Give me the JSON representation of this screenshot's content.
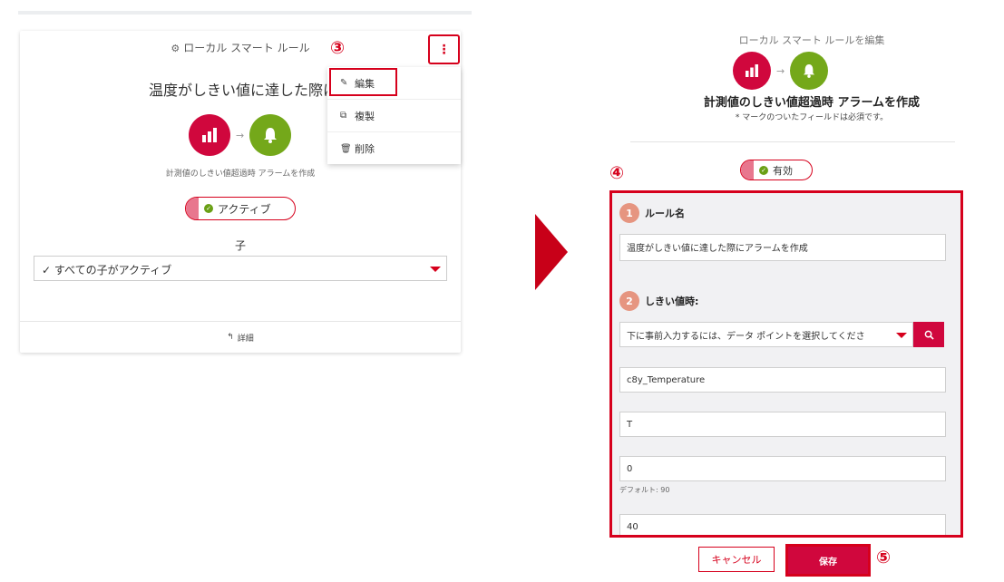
{
  "left_card": {
    "title": "ローカル スマート ルール",
    "rule_name": "温度がしきい値に達した際にアラー",
    "rule_subtitle": "計測値のしきい値超過時 アラームを作成",
    "toggle_label": "アクティブ",
    "children_label": "子",
    "children_select": "すべての子がアクティブ",
    "footer_label": "詳細"
  },
  "menu": {
    "items": [
      {
        "label": "編集",
        "icon": "pencil-icon"
      },
      {
        "label": "複製",
        "icon": "copy-icon"
      },
      {
        "label": "削除",
        "icon": "trash-icon"
      }
    ]
  },
  "steps": {
    "three": "③",
    "four": "④",
    "five": "⑤"
  },
  "right_panel": {
    "title": "ローカル スマート ルールを編集",
    "headline": "計測値のしきい値超過時 アラームを作成",
    "required_note": "* マークのついたフィールドは必須です。",
    "toggle_label": "有効",
    "section1": {
      "number": "1",
      "label": "ルール名",
      "value": "温度がしきい値に達した際にアラームを作成"
    },
    "section2": {
      "number": "2",
      "label": "しきい値時:",
      "datapoint_placeholder": "下に事前入力するには、データ ポイントを選択してくださ",
      "fragment": "c8y_Temperature",
      "series": "T",
      "min": "0",
      "min_hint": "デフォルト: 90",
      "max": "40"
    },
    "cancel_label": "キャンセル",
    "save_label": "保存"
  },
  "colors": {
    "accent": "#d6001c",
    "measurement": "#d0073d",
    "alarm": "#74a81a"
  }
}
